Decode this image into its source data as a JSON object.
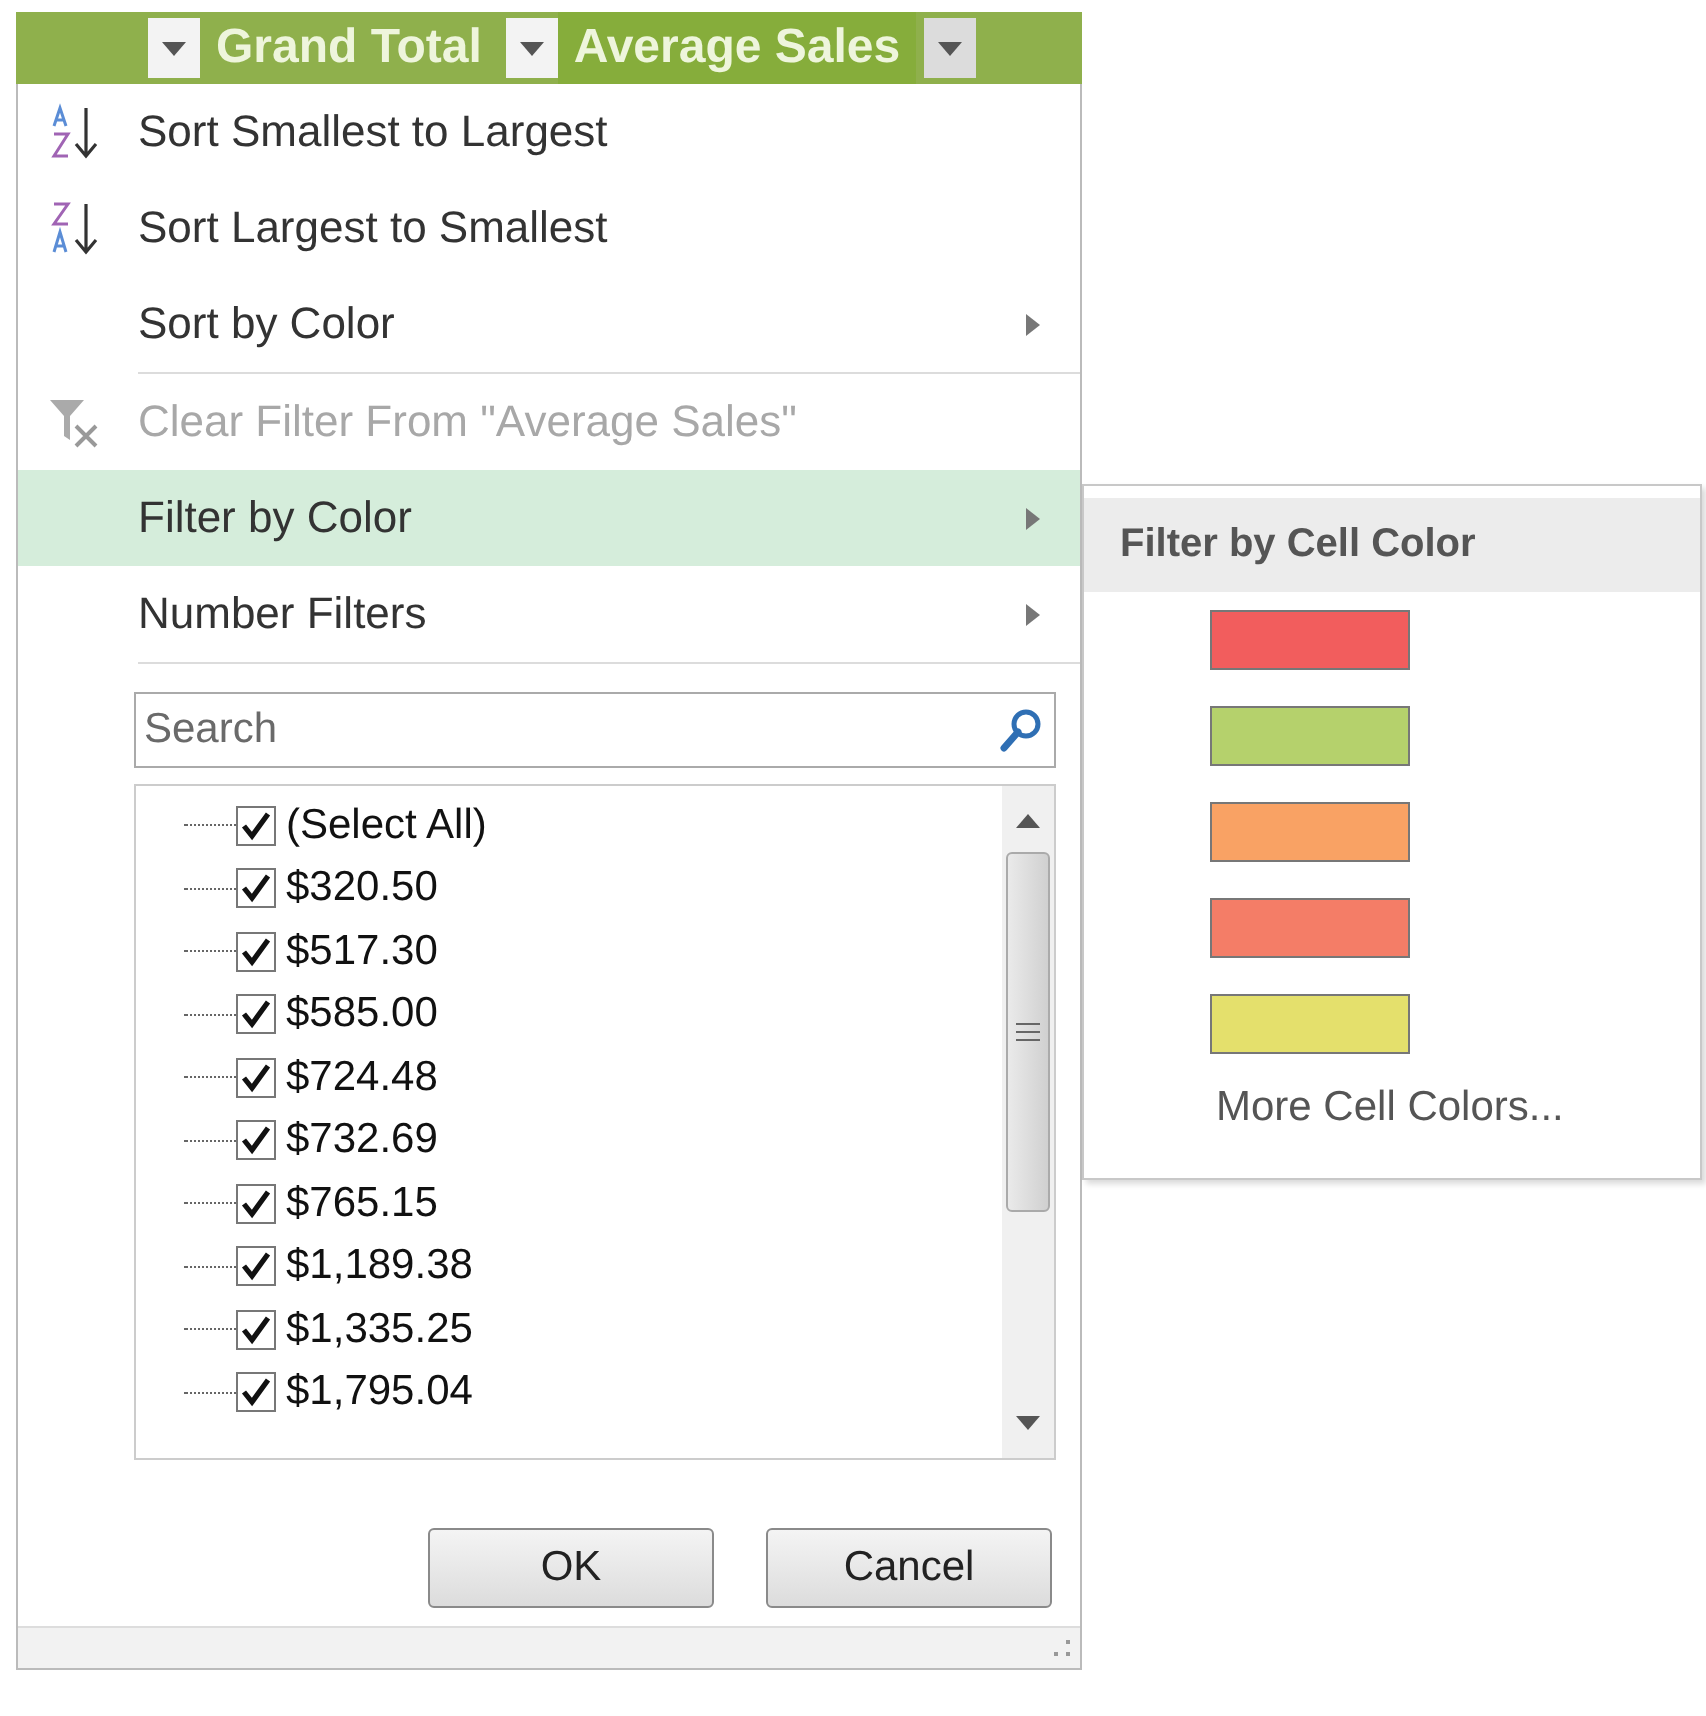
{
  "header": {
    "columns": [
      {
        "label": "Grand Total",
        "selected": false
      },
      {
        "label": "Average Sales",
        "selected": true
      }
    ]
  },
  "menu": {
    "items": [
      {
        "kind": "sort-asc",
        "label": "Sort Smallest to Largest",
        "disabled": false,
        "selected": false,
        "submenu": false
      },
      {
        "kind": "sort-desc",
        "label": "Sort Largest to Smallest",
        "disabled": false,
        "selected": false,
        "submenu": false
      },
      {
        "kind": "plain",
        "label": "Sort by Color",
        "disabled": false,
        "selected": false,
        "submenu": true
      },
      {
        "kind": "separator"
      },
      {
        "kind": "clear-filter",
        "label": "Clear Filter From \"Average Sales\"",
        "disabled": true,
        "selected": false,
        "submenu": false
      },
      {
        "kind": "plain",
        "label": "Filter by Color",
        "disabled": false,
        "selected": true,
        "submenu": true
      },
      {
        "kind": "plain",
        "label": "Number Filters",
        "disabled": false,
        "selected": false,
        "submenu": true
      },
      {
        "kind": "separator"
      }
    ]
  },
  "search": {
    "placeholder": "Search"
  },
  "values": [
    {
      "label": "(Select All)",
      "checked": true
    },
    {
      "label": "$320.50",
      "checked": true
    },
    {
      "label": "$517.30",
      "checked": true
    },
    {
      "label": "$585.00",
      "checked": true
    },
    {
      "label": "$724.48",
      "checked": true
    },
    {
      "label": "$732.69",
      "checked": true
    },
    {
      "label": "$765.15",
      "checked": true
    },
    {
      "label": "$1,189.38",
      "checked": true
    },
    {
      "label": "$1,335.25",
      "checked": true
    },
    {
      "label": "$1,795.04",
      "checked": true
    }
  ],
  "buttons": [
    "OK",
    "Cancel"
  ],
  "submenu": {
    "title": "Filter by Cell Color",
    "swatches": [
      {
        "color": "#f25d5d"
      },
      {
        "color": "#b5d16c"
      },
      {
        "color": "#f9a264"
      },
      {
        "color": "#f47d67"
      },
      {
        "color": "#e4e06c"
      }
    ],
    "more": "More Cell Colors..."
  }
}
